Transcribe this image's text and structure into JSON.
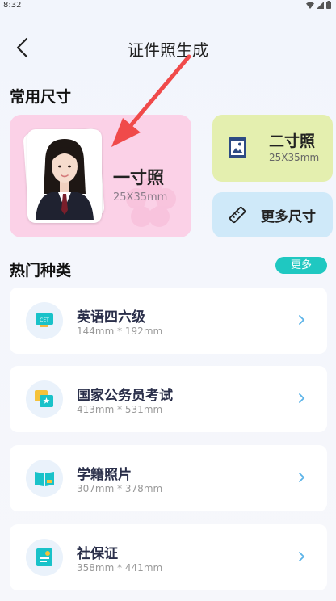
{
  "status": {
    "time": "8:32"
  },
  "header": {
    "title": "证件照生成"
  },
  "common": {
    "title": "常用尺寸",
    "one_inch": {
      "name": "一寸照",
      "dim": "25X35mm"
    },
    "two_inch": {
      "name": "二寸照",
      "dim": "25X35mm"
    },
    "more_sizes": {
      "name": "更多尺寸"
    }
  },
  "hot": {
    "title": "热门种类",
    "more_label": "更多",
    "items": [
      {
        "title": "英语四六级",
        "dim": "144mm * 192mm",
        "icon": "cet-icon",
        "badge": "CET"
      },
      {
        "title": "国家公务员考试",
        "dim": "413mm * 531mm",
        "icon": "civil-service-icon"
      },
      {
        "title": "学籍照片",
        "dim": "307mm * 378mm",
        "icon": "book-icon"
      },
      {
        "title": "社保证",
        "dim": "358mm * 441mm",
        "icon": "social-security-card-icon"
      }
    ]
  },
  "colors": {
    "accent": "#1fc8c1",
    "pink_card": "#fbd1e7",
    "green_card": "#e4efaf",
    "blue_card": "#cfe9f9",
    "annotation_arrow": "#f04a4a"
  }
}
